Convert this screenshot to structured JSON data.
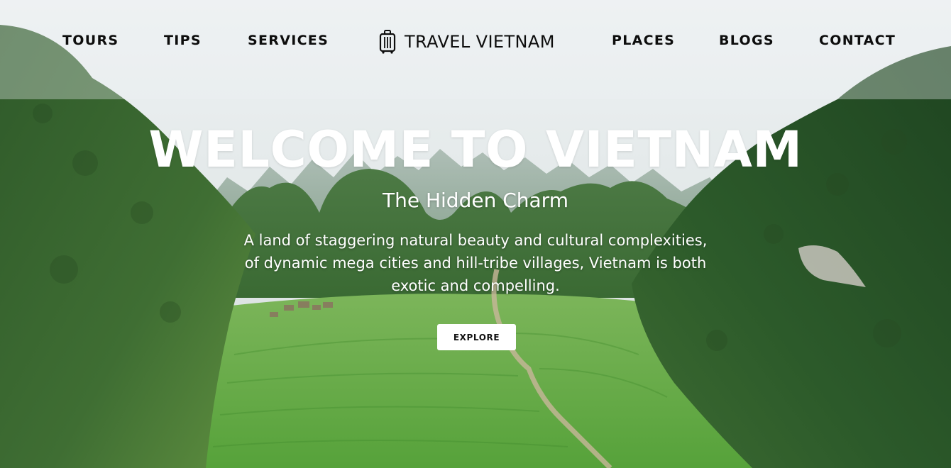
{
  "nav": {
    "left": [
      {
        "label": "TOURS"
      },
      {
        "label": "TIPS"
      },
      {
        "label": "SERVICES"
      }
    ],
    "right": [
      {
        "label": "PLACES"
      },
      {
        "label": "BLOGS"
      },
      {
        "label": "CONTACT"
      }
    ],
    "brand": {
      "label": "TRAVEL VIETNAM",
      "icon": "suitcase-icon"
    }
  },
  "hero": {
    "title": "WELCOME TO VIETNAM",
    "subtitle": "The Hidden Charm",
    "description": "A land of staggering natural beauty and cultural complexities, of dynamic mega cities and hill-tribe villages, Vietnam is both exotic and compelling.",
    "cta_label": "EXPLORE",
    "background": "mountain-valley-photo"
  },
  "colors": {
    "nav_text": "#0d0d0d",
    "hero_text": "#ffffff",
    "button_bg": "#ffffff",
    "button_text": "#111111"
  }
}
